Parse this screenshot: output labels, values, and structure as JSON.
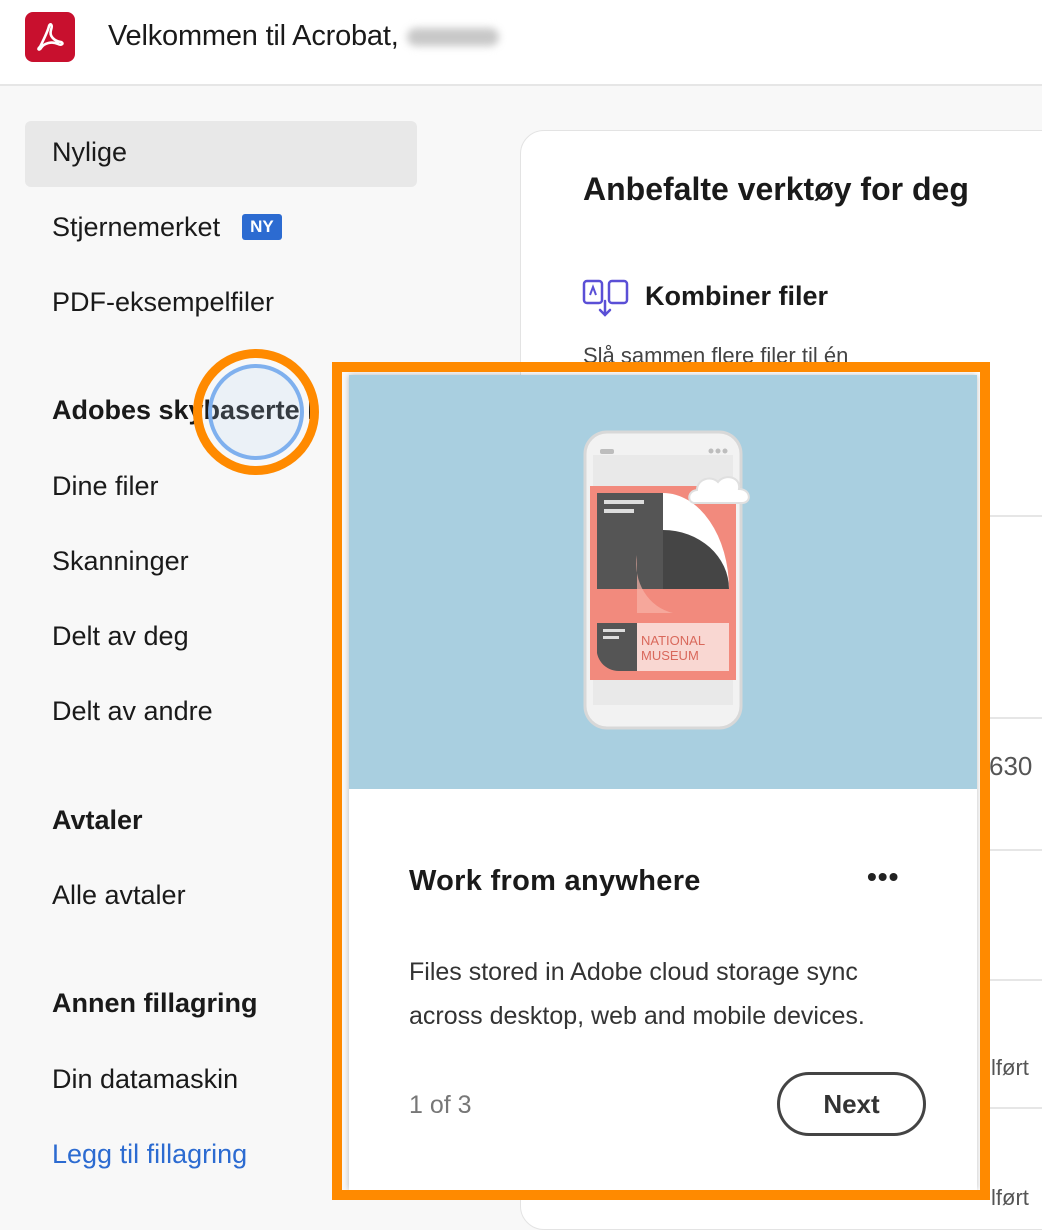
{
  "header": {
    "welcome_text": "Velkommen til Acrobat,"
  },
  "sidebar": {
    "items": [
      {
        "label": "Nylige"
      },
      {
        "label": "Stjernemerket",
        "badge": "NY"
      },
      {
        "label": "PDF-eksempelfiler"
      }
    ],
    "cloud_section": {
      "heading": "Adobes skybaserte l",
      "items": [
        "Dine filer",
        "Skanninger",
        "Delt av deg",
        "Delt av andre"
      ]
    },
    "agreements_section": {
      "heading": "Avtaler",
      "items": [
        "Alle avtaler"
      ]
    },
    "other_storage_section": {
      "heading": "Annen fillagring",
      "items": [
        "Din datamaskin"
      ],
      "add_link": "Legg til fillagring"
    }
  },
  "panel": {
    "title": "Anbefalte verktøy for deg",
    "tool_name": "Kombiner filer",
    "tool_icon": "combine-files-icon",
    "tool_desc": "Slå sammen flere filer til én",
    "peek_values": [
      "630",
      "lført",
      "lført"
    ]
  },
  "coachmark": {
    "title": "Work from anywhere",
    "body": "Files stored in Adobe cloud storage sync across desktop, web and mobile devices.",
    "counter": "1 of 3",
    "next_label": "Next",
    "illustration_text": [
      "NATIONAL",
      "MUSEUM"
    ]
  },
  "colors": {
    "accent": "#ff8a00",
    "brand": "#c8102e",
    "badge": "#2c6bd1",
    "link": "#2c6bd1",
    "hero_bg": "#a9cfe0"
  }
}
